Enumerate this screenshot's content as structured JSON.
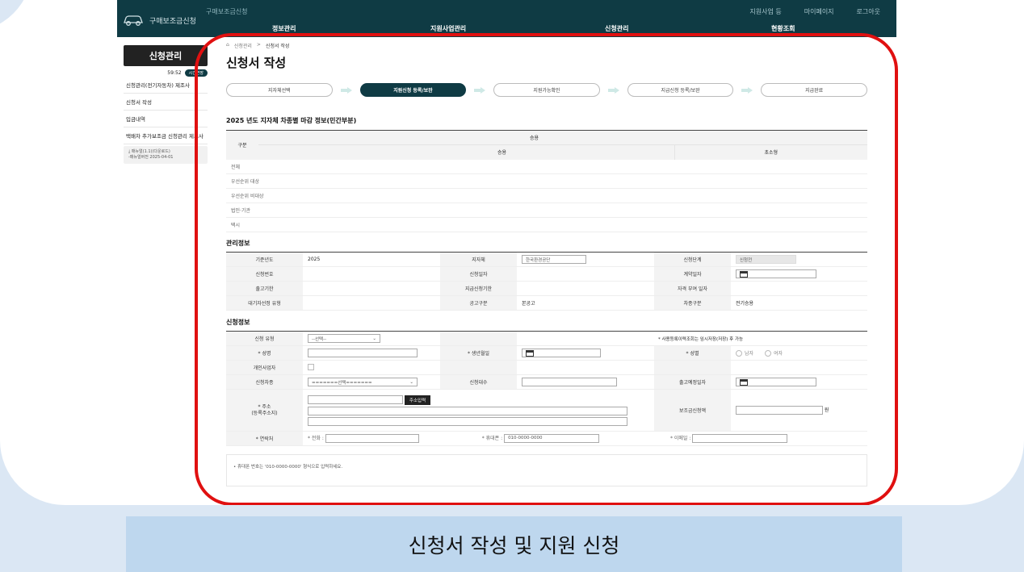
{
  "app": {
    "logo_text": "구매보조금신청",
    "sub_text": "구매보조금신청",
    "util": [
      "지원사업 등",
      "마이페이지",
      "로그아웃"
    ],
    "menu": [
      "정보관리",
      "지원사업관리",
      "신청관리",
      "현황조회"
    ]
  },
  "sidebar": {
    "title": "신청관리",
    "time": "59:52",
    "extend_label": "시간연장",
    "items": [
      {
        "label": "신청관리(전기자동차) 제조사"
      },
      {
        "label": "신청서 작성"
      },
      {
        "label": "입금내역"
      },
      {
        "label": "택배차 추가보조금 신청관리 제조사"
      }
    ],
    "download": {
      "line1": "매뉴얼(1.1)(다운로드)",
      "line2": "-매뉴얼버전 2025-04-01"
    }
  },
  "breadcrumb": {
    "sep": ">",
    "items": [
      "신청관리",
      "신청서 작성"
    ]
  },
  "page_title": "신청서 작성",
  "steps": [
    {
      "label": "지자체선택",
      "active": false
    },
    {
      "label": "지원신청 등록/보완",
      "active": true
    },
    {
      "label": "지원가능확인",
      "active": false
    },
    {
      "label": "지급신청 등록/보완",
      "active": false
    },
    {
      "label": "지급완료",
      "active": false
    }
  ],
  "deadline": {
    "title": "2025 년도 지자체 차종별 마감 정보(민간부분)",
    "col_group": "구분",
    "col_top": "승용",
    "col_sub1": "승용",
    "col_sub2": "초소형",
    "rows": [
      "전체",
      "우선순위 대상",
      "우선순위 비대상",
      "법인·기관",
      "택시"
    ]
  },
  "manage": {
    "title": "관리정보",
    "year_label": "기준년도",
    "year_value": "2025",
    "local_label": "지자체",
    "local_value": "한국환경공단",
    "stage_label": "신청단계",
    "stage_value": "신청전",
    "appno_label": "신청번호",
    "appdate_label": "신청일자",
    "contract_label": "계약일자",
    "release_label": "출고기한",
    "payreq_label": "지급신청기한",
    "qualify_label": "자격 부여 일자",
    "wait_label": "대기자선정 유형",
    "notice_label": "공고구분",
    "notice_value": "본공고",
    "cartype_label": "차종구분",
    "cartype_value": "전기승용"
  },
  "apply": {
    "title": "신청정보",
    "type_label": "신청 유형",
    "type_value": "--선택--",
    "note": "* 사용등록이력조회는 임시저장(저장) 후 가능",
    "name_label": "* 성명",
    "birth_label": "* 생년월일",
    "gender_label": "* 성별",
    "male": "남자",
    "female": "여자",
    "biz_label": "개인사업자",
    "model_label": "신청차종",
    "model_value": "=======선택=======",
    "count_label": "신청대수",
    "release_date_label": "출고예정일자",
    "addr_label1": "* 주소",
    "addr_label2": "(등록주소지)",
    "addr_btn": "주소입력",
    "subsidy_label": "보조금신청액",
    "won": "원",
    "contact_label": "* 연락처",
    "phone_label": "* 전화 :",
    "mobile_label": "* 휴대폰 :",
    "mobile_placeholder": "010-0000-0000",
    "email_label": "* 이메일 :"
  },
  "footnote": "• 휴대폰 번호는 '010-0000-0000' 형식으로 입력하세요.",
  "caption": "신청서 작성 및 지원 신청",
  "colors": {
    "topbar": "#0f3b44",
    "highlight": "#e01010",
    "caption_bg": "#bed7ee"
  }
}
